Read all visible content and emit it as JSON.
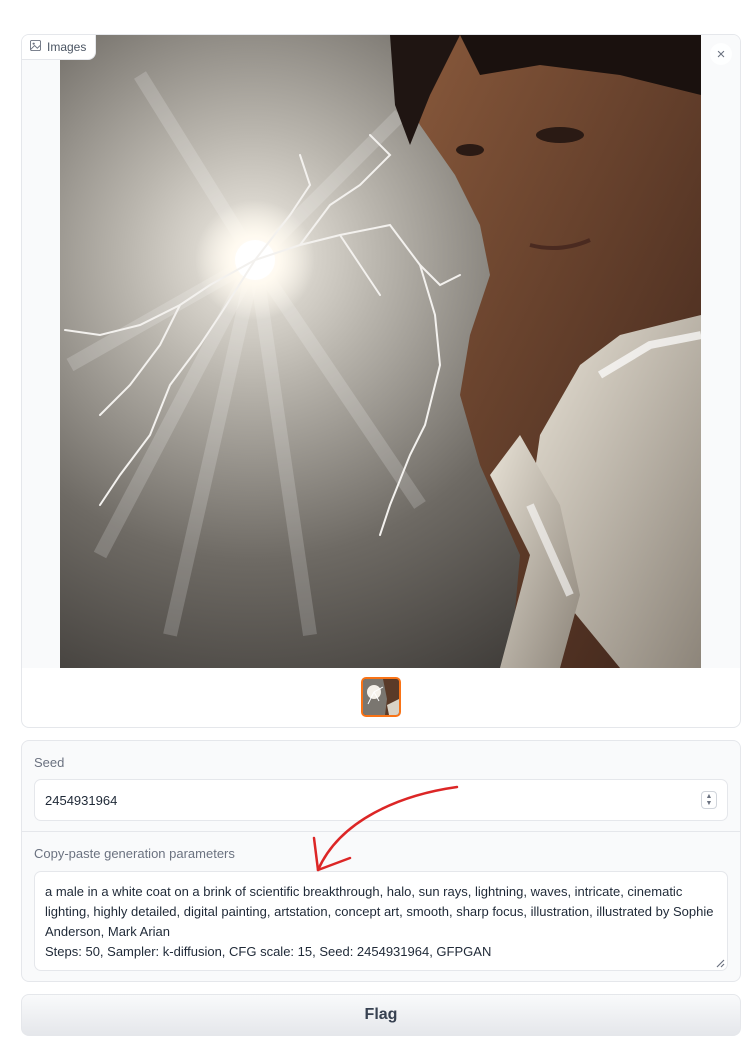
{
  "gallery": {
    "label": "Images",
    "label_icon": "image-icon",
    "close_icon": "close-icon",
    "close_glyph": "×",
    "preview_alt": "Generated image preview"
  },
  "seed": {
    "label": "Seed",
    "value": "2454931964",
    "spinner_icon": "stepper-arrows-icon"
  },
  "generation_params": {
    "label": "Copy-paste generation parameters",
    "lines": [
      "a male in a white coat on a brink of scientific breakthrough, halo, sun rays, lightning, waves, intricate, cinematic lighting, highly detailed, digital painting, artstation, concept art, smooth, sharp focus, illustration, illustrated by Sophie Anderson, Mark Arian",
      "Steps: 50, Sampler: k-diffusion, CFG scale: 15, Seed: 2454931964, GFPGAN"
    ]
  },
  "flag_button": {
    "label": "Flag"
  },
  "colors": {
    "selected_thumb_border": "#f97316",
    "annotation_arrow": "#dc2626"
  }
}
